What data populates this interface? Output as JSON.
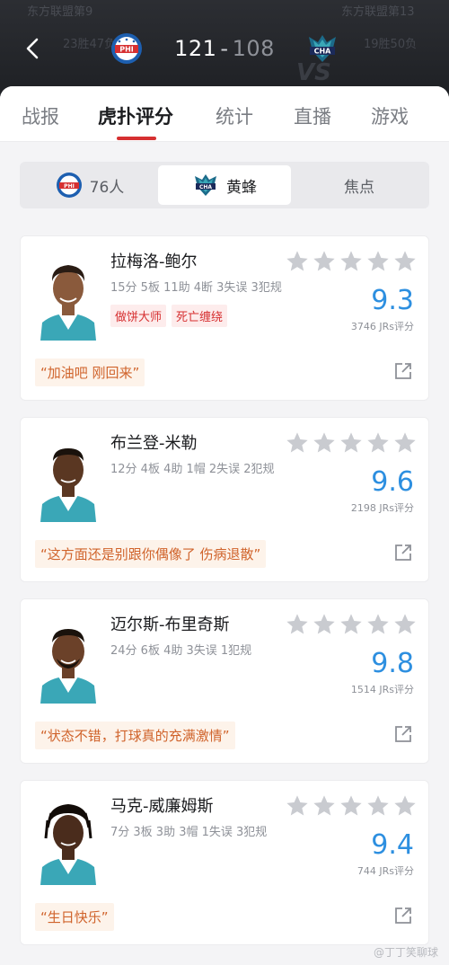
{
  "header": {
    "ghost_left_1": "东方联盟第9",
    "ghost_right_1": "东方联盟第13",
    "ghost_left_2": "23胜47负",
    "ghost_right_2": "19胜50负",
    "vs_ghost": "VS",
    "home_score": "121",
    "separator": "-",
    "away_score": "108",
    "home_logo_text": "PHI",
    "away_logo_text": "CHA"
  },
  "tabs": [
    {
      "label": "战报",
      "active": false
    },
    {
      "label": "虎扑评分",
      "active": true
    },
    {
      "label": "统计",
      "active": false
    },
    {
      "label": "直播",
      "active": false
    },
    {
      "label": "游戏",
      "active": false
    }
  ],
  "segments": [
    {
      "label": "76人",
      "logo": "PHI",
      "active": false
    },
    {
      "label": "黄蜂",
      "logo": "CHA",
      "active": true
    },
    {
      "label": "焦点",
      "active": false
    }
  ],
  "players": [
    {
      "name": "拉梅洛-鲍尔",
      "stats": "15分 5板 11助 4断 3失误 3犯规",
      "tags": [
        "做饼大师",
        "死亡缠绕"
      ],
      "rating": "9.3",
      "jrs": "3746 JRs评分",
      "quote": "“加油吧 刚回来”",
      "skin": "#8a5a3c",
      "hair": "#2a1c14"
    },
    {
      "name": "布兰登-米勒",
      "stats": "12分 4板 4助 1帽 2失误 2犯规",
      "tags": [],
      "rating": "9.6",
      "jrs": "2198 JRs评分",
      "quote": "“这方面还是别跟你偶像了 伤病退散”",
      "skin": "#5a3722",
      "hair": "#1a120c"
    },
    {
      "name": "迈尔斯-布里奇斯",
      "stats": "24分 6板 4助 3失误 1犯规",
      "tags": [],
      "rating": "9.8",
      "jrs": "1514 JRs评分",
      "quote": "“状态不错，打球真的充满激情”",
      "skin": "#6b4129",
      "hair": "#1a120c"
    },
    {
      "name": "马克-威廉姆斯",
      "stats": "7分 3板 3助 3帽 1失误 3犯规",
      "tags": [],
      "rating": "9.4",
      "jrs": "744 JRs评分",
      "quote": "“生日快乐”",
      "skin": "#4a2c1c",
      "hair": "#120c08"
    }
  ],
  "watermark": "@丁丁笑聊球",
  "colors": {
    "accent_red": "#d63031",
    "rating_blue": "#2d8fe0",
    "quote_orange": "#d0632b",
    "star_gray": "#c9cbd0",
    "jersey_teal": "#3aa7b7"
  }
}
